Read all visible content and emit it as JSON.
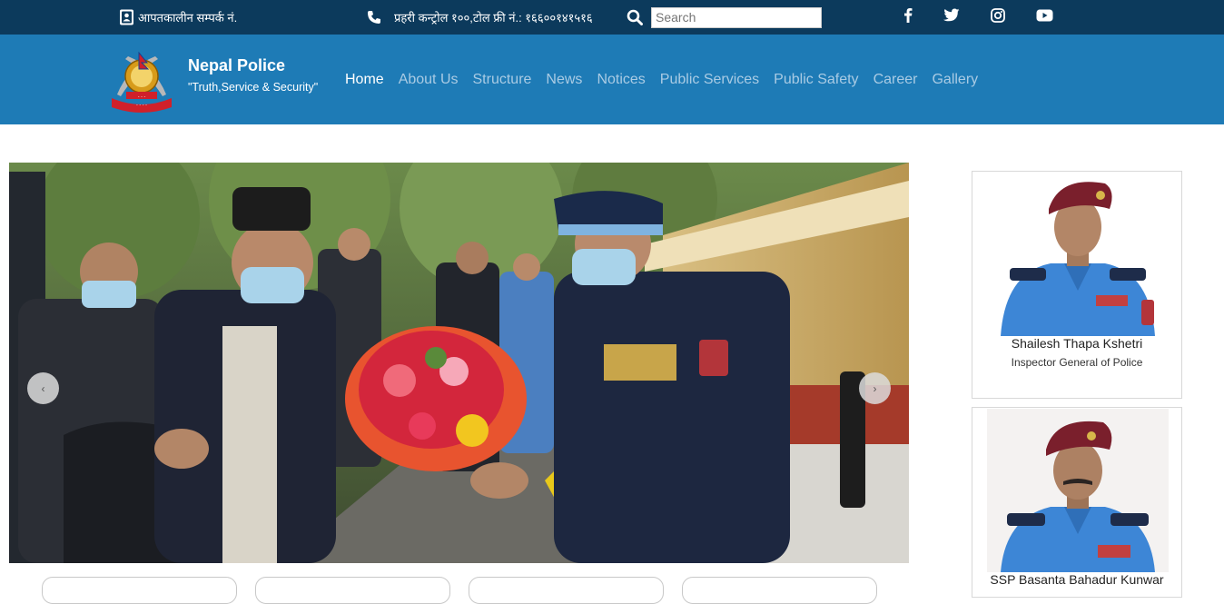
{
  "topbar": {
    "emergency_text": "आपतकालीन सम्पर्क नं.",
    "control_text": "प्रहरी कन्ट्रोल १००,टोल फ्री नं.: १६६००१४१५१६",
    "search_placeholder": "Search",
    "social_icons": [
      "facebook-icon",
      "twitter-icon",
      "instagram-icon",
      "youtube-icon"
    ]
  },
  "brand": {
    "name": "Nepal Police",
    "tagline": "\"Truth,Service & Security\""
  },
  "nav": {
    "items": [
      "Home",
      "About Us",
      "Structure",
      "News",
      "Notices",
      "Public Services",
      "Public Safety",
      "Career",
      "Gallery"
    ],
    "active": "Home"
  },
  "carousel": {
    "prev_label": "‹",
    "next_label": "›"
  },
  "officers": [
    {
      "name": "Shailesh Thapa Kshetri",
      "title": "Inspector General of Police"
    },
    {
      "name": "SSP Basanta Bahadur Kunwar",
      "title": ""
    }
  ],
  "colors": {
    "topbar": "#0c3a5c",
    "navbar": "#1e7bb6",
    "nav_active": "#ffffff",
    "nav_inactive": "#a9cbe4"
  }
}
